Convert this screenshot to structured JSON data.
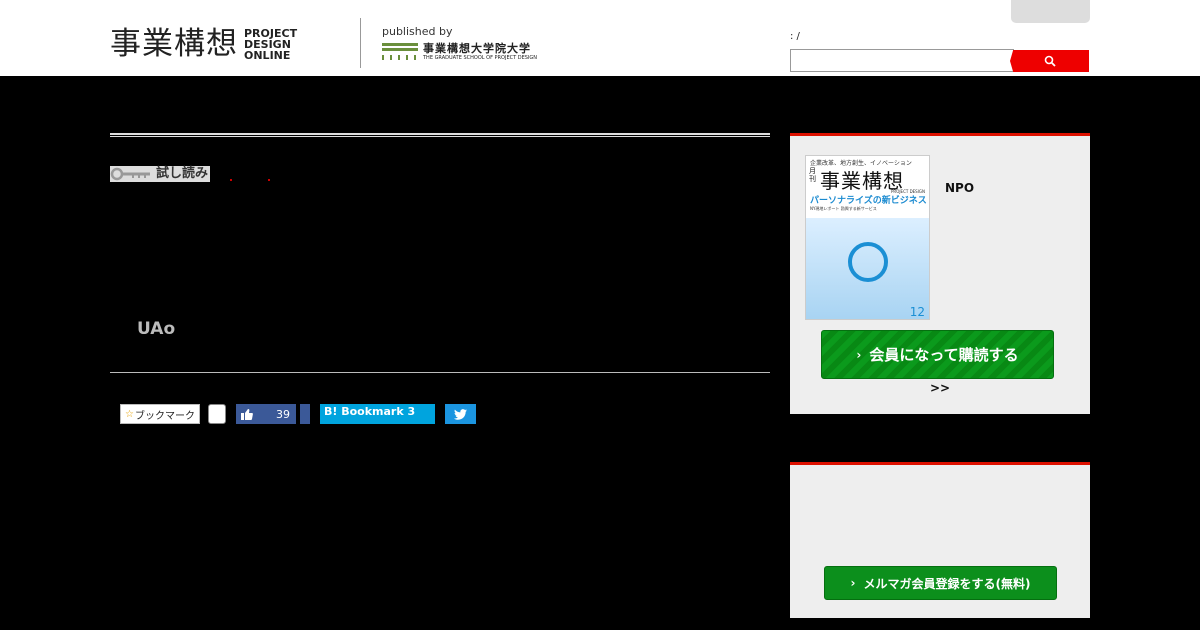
{
  "header": {
    "logo_jp": "事業構想",
    "logo_en_lines": [
      "PROJECT",
      "DESIGN",
      "ONLINE"
    ],
    "published_by": "published by",
    "grad_school_jp": "事業構想大学院大学",
    "grad_school_en": "THE GRADUATE SCHOOL OF PROJECT DESIGN",
    "breadcrumb": ":    /",
    "search_placeholder": "",
    "search_icon": "search-icon"
  },
  "article": {
    "trial_label": "試し読み",
    "author": "UAo"
  },
  "share": {
    "bookmark_label": "ブックマーク",
    "facebook_count": "39",
    "hatena_label": "B! Bookmark",
    "hatena_count": "3"
  },
  "sidebar": {
    "magazine": {
      "cover_top": "企業改革、地方創生、イノベーション",
      "cover_month": "月刊",
      "cover_title": "事業構想",
      "cover_en": "PROJECT DESIGN",
      "cover_headline": "パーソナライズの新ビジネス",
      "cover_sub": "NY現地レポート 勃興する新サービス",
      "cover_issue": "12",
      "npo_label": "NPO",
      "subscribe_button": "会員になって購読する",
      "more_link": ">>"
    },
    "newsletter": {
      "button": "メルマガ会員登録をする(無料)"
    }
  },
  "colors": {
    "accent_red": "#dd1100",
    "green_button": "#0b9a1c",
    "facebook": "#3b5998",
    "hatena": "#00a4de",
    "twitter": "#1b95e0"
  }
}
